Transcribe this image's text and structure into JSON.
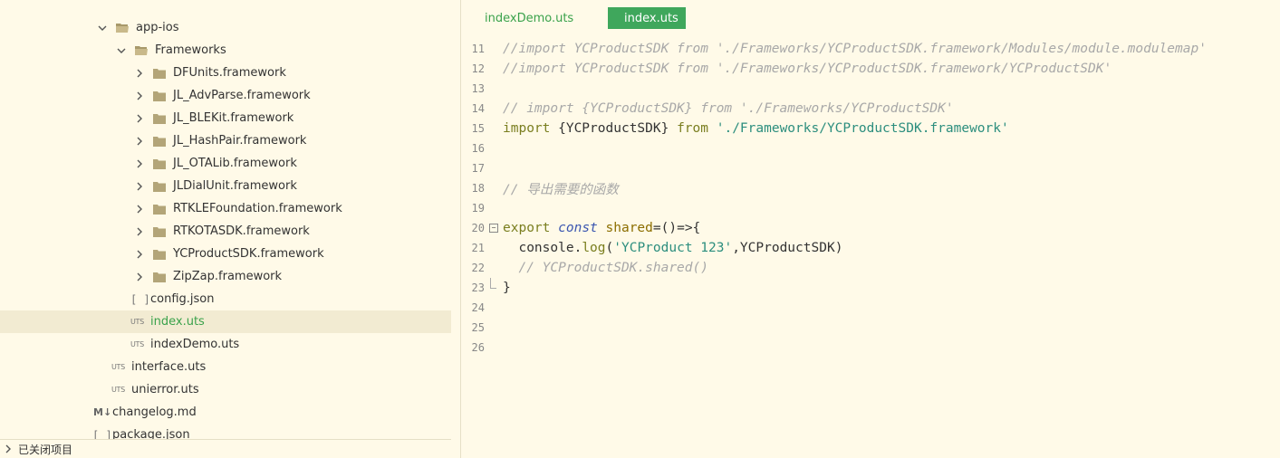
{
  "sidebar": {
    "items": [
      {
        "label": "app-ios",
        "type": "folder",
        "expanded": true,
        "level": 1
      },
      {
        "label": "Frameworks",
        "type": "folder",
        "expanded": true,
        "level": 2
      },
      {
        "label": "DFUnits.framework",
        "type": "folder",
        "expanded": false,
        "level": 3
      },
      {
        "label": "JL_AdvParse.framework",
        "type": "folder",
        "expanded": false,
        "level": 3
      },
      {
        "label": "JL_BLEKit.framework",
        "type": "folder",
        "expanded": false,
        "level": 3
      },
      {
        "label": "JL_HashPair.framework",
        "type": "folder",
        "expanded": false,
        "level": 3
      },
      {
        "label": "JL_OTALib.framework",
        "type": "folder",
        "expanded": false,
        "level": 3
      },
      {
        "label": "JLDialUnit.framework",
        "type": "folder",
        "expanded": false,
        "level": 3
      },
      {
        "label": "RTKLEFoundation.framework",
        "type": "folder",
        "expanded": false,
        "level": 3
      },
      {
        "label": "RTKOTASDK.framework",
        "type": "folder",
        "expanded": false,
        "level": 3
      },
      {
        "label": "YCProductSDK.framework",
        "type": "folder",
        "expanded": false,
        "level": 3
      },
      {
        "label": "ZipZap.framework",
        "type": "folder",
        "expanded": false,
        "level": 3
      },
      {
        "label": "config.json",
        "type": "json",
        "badge": "[ ]",
        "level": 2
      },
      {
        "label": "index.uts",
        "type": "uts",
        "badge": "UTS",
        "level": 2,
        "selected": true
      },
      {
        "label": "indexDemo.uts",
        "type": "uts",
        "badge": "UTS",
        "level": 2
      },
      {
        "label": "interface.uts",
        "type": "uts",
        "badge": "UTS",
        "level": 1
      },
      {
        "label": "unierror.uts",
        "type": "uts",
        "badge": "UTS",
        "level": 1
      },
      {
        "label": "changelog.md",
        "type": "md",
        "badge": "M↓",
        "level": 0
      },
      {
        "label": "package.json",
        "type": "json",
        "badge": "[ ]",
        "level": 0
      }
    ],
    "footer_label": "已关闭项目"
  },
  "tabs": [
    {
      "label": "indexDemo.uts",
      "active": false
    },
    {
      "label": "index.uts",
      "active": true
    }
  ],
  "code": {
    "line_numbers": [
      "11",
      "12",
      "13",
      "14",
      "15",
      "16",
      "17",
      "18",
      "19",
      "20",
      "21",
      "22",
      "23",
      "24",
      "25",
      "26"
    ],
    "l11": "//import YCProductSDK from './Frameworks/YCProductSDK.framework/Modules/module.modulemap'",
    "l12": "//import YCProductSDK from './Frameworks/YCProductSDK.framework/YCProductSDK'",
    "l14": "// import {YCProductSDK} from './Frameworks/YCProductSDK'",
    "l15_kw": "import",
    "l15_mid": " {YCProductSDK} ",
    "l15_from": "from",
    "l15_str": " './Frameworks/YCProductSDK.framework'",
    "l18": "// 导出需要的函数",
    "l20_export": "export",
    "l20_const": "const",
    "l20_name": "shared",
    "l20_rest": "=()=>{",
    "l21_a": "  console.",
    "l21_b": "log",
    "l21_c": "(",
    "l21_str": "'YCProduct 123'",
    "l21_d": ",YCProductSDK)",
    "l22": "  // YCProductSDK.shared()",
    "l23": "}"
  },
  "colors": {
    "background": "#fffae8",
    "accent_green": "#3fa75c",
    "selected_text": "#3aa24b",
    "comment": "#a8a8a8",
    "keyword": "#7a7e1f",
    "string": "#2c8e7e"
  }
}
